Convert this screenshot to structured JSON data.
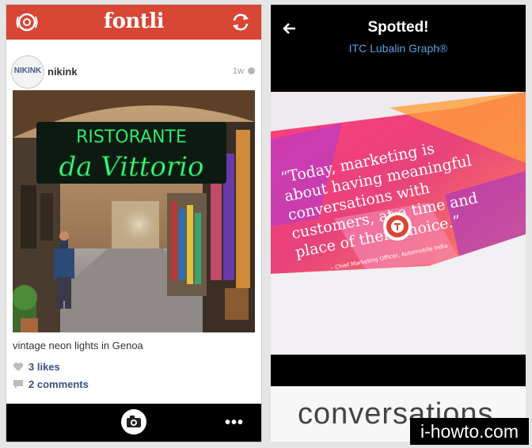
{
  "left": {
    "app_title": "fontli",
    "post": {
      "avatar_text": "NIKINK",
      "username": "nikink",
      "time": "1w",
      "caption": "vintage neon lights in Genoa",
      "likes": "3 likes",
      "comments": "2 comments"
    },
    "photo_signs": {
      "line1": "RISTORANTE",
      "line2": "da Vittorio"
    },
    "bottom_menu": "•••"
  },
  "right": {
    "title": "Spotted!",
    "font_name": "ITC Lubalin Graph®",
    "quote_lines": [
      "“Today, marketing is",
      "about having meaningful",
      "conversations with",
      "customers, at a time and",
      "place of their choice.”"
    ],
    "quote_attribution": "– Chief Marketing Officer, Automobile India",
    "preview_word": "conversations"
  },
  "watermark": "i-howto.com",
  "colors": {
    "brand_red": "#d84635",
    "link_blue": "#3a4f80",
    "font_blue": "#5aa0e0",
    "neon_green": "#3cff7a"
  }
}
